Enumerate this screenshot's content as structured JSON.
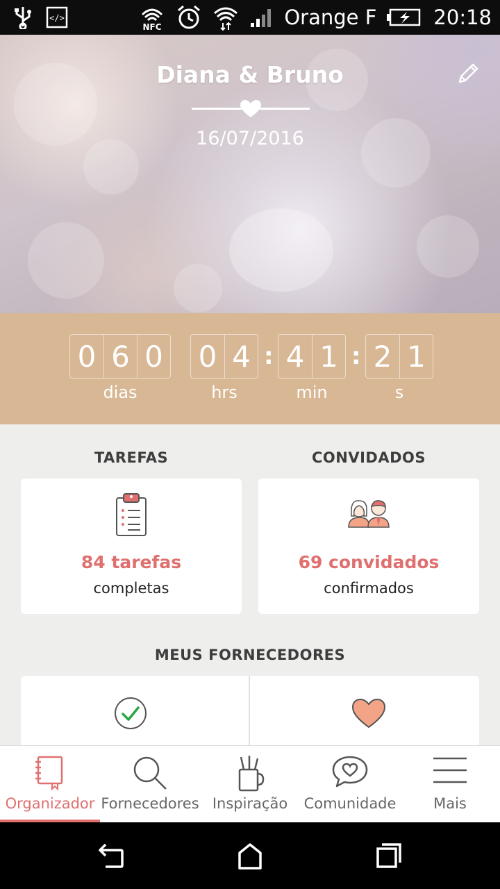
{
  "status_bar": {
    "carrier": "Orange F",
    "time": "20:18",
    "icons": [
      "usb-icon",
      "code-icon",
      "nfc-icon",
      "alarm-icon",
      "wifi-icon",
      "signal-icon",
      "battery-charging-icon"
    ],
    "nfc_text": "NFC"
  },
  "hero": {
    "title": "Diana & Bruno",
    "date": "16/07/2016"
  },
  "countdown": {
    "days": [
      "0",
      "6",
      "0"
    ],
    "hours": [
      "0",
      "4"
    ],
    "minutes": [
      "4",
      "1"
    ],
    "seconds": [
      "2",
      "1"
    ],
    "separator": ":",
    "labels": {
      "days": "dias",
      "hours": "hrs",
      "minutes": "min",
      "seconds": "s"
    }
  },
  "tasks": {
    "title": "TAREFAS",
    "stat": "84 tarefas",
    "sub": "completas"
  },
  "guests": {
    "title": "CONVIDADOS",
    "stat": "69 convidados",
    "sub": "confirmados"
  },
  "vendors": {
    "title": "MEUS FORNECEDORES"
  },
  "bottom_nav": {
    "items": [
      {
        "label": "Organizador",
        "icon": "notebook-icon",
        "active": true
      },
      {
        "label": "Fornecedores",
        "icon": "search-icon",
        "active": false
      },
      {
        "label": "Inspiração",
        "icon": "pencil-cup-icon",
        "active": false
      },
      {
        "label": "Comunidade",
        "icon": "chat-heart-icon",
        "active": false
      },
      {
        "label": "Mais",
        "icon": "menu-icon",
        "active": false
      }
    ]
  },
  "colors": {
    "accent": "#e06f6f",
    "countdown_bg": "#d8b794",
    "content_bg": "#eeeeed"
  }
}
